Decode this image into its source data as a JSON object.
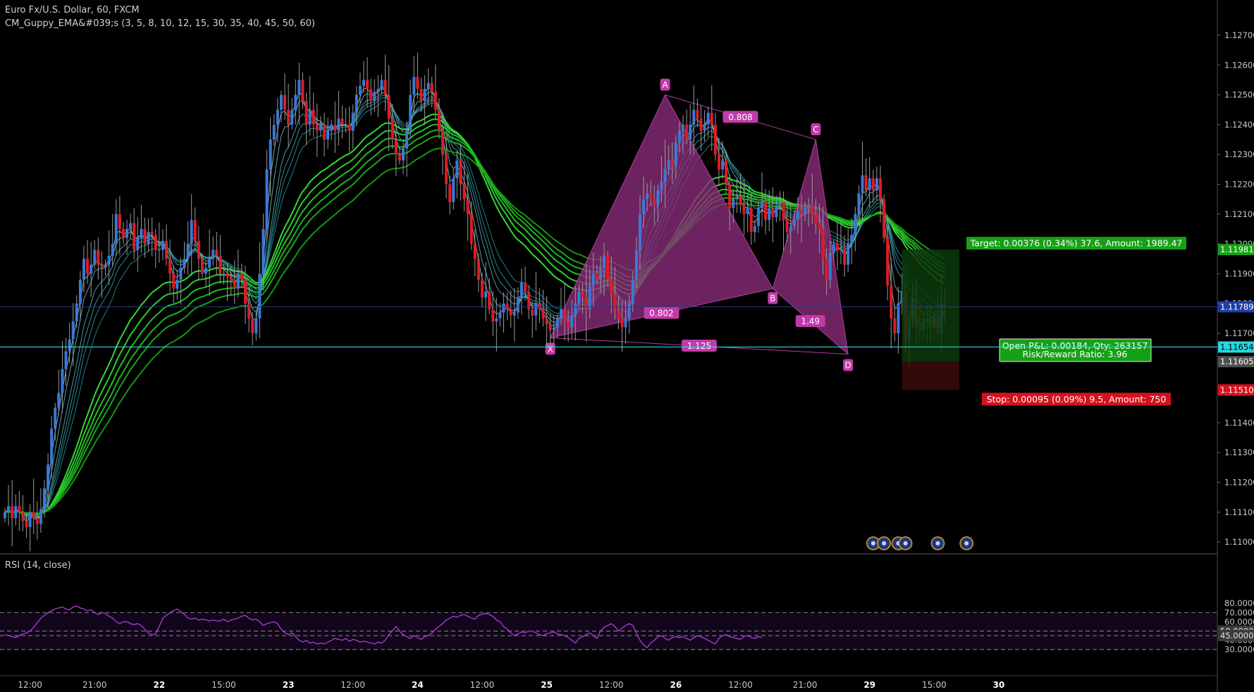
{
  "header": {
    "title": "Euro Fx/U.S. Dollar, 60, FXCM",
    "indicator": "CM_Guppy_EMA&#039;s (3, 5, 8, 10, 12, 15, 30, 35, 40, 45, 50, 60)"
  },
  "rsi_panel": {
    "title": "RSI (14, close)"
  },
  "colors": {
    "background": "#000000",
    "bull_candle": "#3a78d8",
    "bear_candle": "#e01b24",
    "short_ema_teal": "#2ec4c4",
    "long_ema_green": "#1fd11f",
    "pattern_fill": "#8a2d7a",
    "pattern_label": "#c03aa8",
    "rsi_line": "#b23cd6",
    "target_green": "#16a016",
    "stop_red": "#d4121e",
    "cyan_line": "#25d9e0",
    "price_line": "#2a3a8a"
  },
  "chart_data": [
    {
      "type": "candlestick",
      "symbol": "EURUSD",
      "timeframe": "60",
      "ylim": [
        1.1093,
        1.1283
      ],
      "y_ticks": [
        "1.12700",
        "1.12600",
        "1.12500",
        "1.12400",
        "1.12300",
        "1.12200",
        "1.12100",
        "1.12000",
        "1.11900",
        "1.11800",
        "1.11700",
        "1.11600",
        "1.11500",
        "1.11400",
        "1.11300",
        "1.11200",
        "1.11100",
        "1.11000"
      ],
      "x_ticks": [
        {
          "i": 7,
          "label": "12:00",
          "bold": false
        },
        {
          "i": 25,
          "label": "21:00",
          "bold": false
        },
        {
          "i": 43,
          "label": "22",
          "bold": true
        },
        {
          "i": 61,
          "label": "15:00",
          "bold": false
        },
        {
          "i": 79,
          "label": "23",
          "bold": true
        },
        {
          "i": 97,
          "label": "12:00",
          "bold": false
        },
        {
          "i": 115,
          "label": "24",
          "bold": true
        },
        {
          "i": 133,
          "label": "12:00",
          "bold": false
        },
        {
          "i": 151,
          "label": "25",
          "bold": true
        },
        {
          "i": 169,
          "label": "12:00",
          "bold": false
        },
        {
          "i": 187,
          "label": "26",
          "bold": true
        },
        {
          "i": 205,
          "label": "12:00",
          "bold": false
        },
        {
          "i": 223,
          "label": "21:00",
          "bold": false
        },
        {
          "i": 241,
          "label": "29",
          "bold": true
        },
        {
          "i": 259,
          "label": "15:00",
          "bold": false
        },
        {
          "i": 277,
          "label": "30",
          "bold": true
        }
      ],
      "closes": [
        1.111,
        1.1112,
        1.1108,
        1.1112,
        1.111,
        1.1107,
        1.1105,
        1.111,
        1.1108,
        1.1106,
        1.1111,
        1.1118,
        1.1126,
        1.1138,
        1.1145,
        1.115,
        1.1158,
        1.1164,
        1.1168,
        1.1174,
        1.118,
        1.1188,
        1.1195,
        1.119,
        1.1193,
        1.1198,
        1.1193,
        1.1192,
        1.1193,
        1.1196,
        1.12,
        1.121,
        1.1205,
        1.1202,
        1.1205,
        1.1207,
        1.1198,
        1.1202,
        1.1205,
        1.12,
        1.1204,
        1.1203,
        1.1198,
        1.1198,
        1.1201,
        1.1195,
        1.119,
        1.1185,
        1.1188,
        1.1192,
        1.1195,
        1.12,
        1.1208,
        1.1201,
        1.1195,
        1.119,
        1.1192,
        1.1195,
        1.1198,
        1.1196,
        1.119,
        1.119,
        1.1189,
        1.1188,
        1.1185,
        1.119,
        1.1188,
        1.118,
        1.1175,
        1.117,
        1.1175,
        1.119,
        1.1205,
        1.1225,
        1.1235,
        1.124,
        1.1245,
        1.125,
        1.1245,
        1.124,
        1.1245,
        1.125,
        1.1255,
        1.1248,
        1.124,
        1.1245,
        1.124,
        1.1238,
        1.124,
        1.1235,
        1.1238,
        1.124,
        1.1238,
        1.1242,
        1.124,
        1.124,
        1.1238,
        1.1244,
        1.125,
        1.1253,
        1.1255,
        1.1252,
        1.1248,
        1.1251,
        1.1252,
        1.1255,
        1.125,
        1.1242,
        1.1235,
        1.123,
        1.1228,
        1.1232,
        1.1238,
        1.125,
        1.1256,
        1.1252,
        1.1248,
        1.1252,
        1.1254,
        1.1251,
        1.1245,
        1.1238,
        1.123,
        1.122,
        1.1214,
        1.1222,
        1.1228,
        1.122,
        1.1215,
        1.121,
        1.12,
        1.1195,
        1.1188,
        1.1182,
        1.1184,
        1.1178,
        1.1174,
        1.1175,
        1.1177,
        1.118,
        1.1178,
        1.1176,
        1.1177,
        1.1182,
        1.1187,
        1.1184,
        1.1178,
        1.1176,
        1.118,
        1.1178,
        1.1175,
        1.1173,
        1.1171,
        1.1172,
        1.1175,
        1.1178,
        1.1174,
        1.1172,
        1.1176,
        1.118,
        1.1184,
        1.1182,
        1.1178,
        1.1186,
        1.119,
        1.1188,
        1.1192,
        1.1196,
        1.1188,
        1.1183,
        1.1178,
        1.1175,
        1.1172,
        1.1175,
        1.118,
        1.1188,
        1.1198,
        1.121,
        1.1215,
        1.1217,
        1.1215,
        1.1213,
        1.1218,
        1.1221,
        1.1225,
        1.1228,
        1.1226,
        1.1234,
        1.1238,
        1.124,
        1.1235,
        1.124,
        1.1245,
        1.1242,
        1.1238,
        1.124,
        1.1244,
        1.124,
        1.123,
        1.1225,
        1.1228,
        1.122,
        1.1212,
        1.1215,
        1.1216,
        1.1213,
        1.121,
        1.1212,
        1.1204,
        1.1206,
        1.1212,
        1.1214,
        1.1208,
        1.1212,
        1.1209,
        1.1213,
        1.1214,
        1.1208,
        1.1204,
        1.1206,
        1.1208,
        1.1211,
        1.121,
        1.1212,
        1.1213,
        1.121,
        1.1207,
        1.1205,
        1.1195,
        1.1188,
        1.1197,
        1.12,
        1.1198,
        1.1199,
        1.1193,
        1.12,
        1.1203,
        1.121,
        1.1217,
        1.1223,
        1.1218,
        1.1222,
        1.1218,
        1.1222,
        1.1215,
        1.1202,
        1.1186,
        1.1175,
        1.117,
        1.118,
        1.1184,
        1.1168,
        1.1174,
        1.1182,
        1.1172,
        1.1171,
        1.1174,
        1.1175,
        1.1172,
        1.1176,
        1.117,
        1.118,
        1.1179
      ],
      "ema_periods": [
        3,
        5,
        8,
        10,
        12,
        15,
        30,
        35,
        40,
        45,
        50,
        60
      ],
      "harmonic_pattern": {
        "points": [
          {
            "label": "X",
            "i": 152,
            "price": 1.11685
          },
          {
            "label": "A",
            "i": 184,
            "price": 1.125
          },
          {
            "label": "B",
            "i": 214,
            "price": 1.1185
          },
          {
            "label": "C",
            "i": 226,
            "price": 1.1235
          },
          {
            "label": "D",
            "i": 235,
            "price": 1.1163
          }
        ],
        "ratios": [
          {
            "label": "0.808",
            "between": [
              "A",
              "C"
            ]
          },
          {
            "label": "0.802",
            "between": [
              "X",
              "B"
            ]
          },
          {
            "label": "1.49",
            "between": [
              "B",
              "D"
            ]
          },
          {
            "label": "1.125",
            "between": [
              "X",
              "D"
            ]
          }
        ]
      },
      "position": {
        "entry": 1.11605,
        "target_price": 1.11981,
        "stop_price": 1.1151,
        "start_i": 250,
        "end_i": 266,
        "target_label": "Target: 0.00376 (0.34%) 37.6, Amount: 1989.47",
        "stop_label": "Stop: 0.00095 (0.09%) 9.5, Amount: 750",
        "pnl_label_1": "Open P&L: 0.00184, Qty: 263157",
        "pnl_label_2": "Risk/Reward Ratio: 3.96"
      },
      "price_line": 1.11789,
      "horizontal_line": 1.11654,
      "price_tags": [
        {
          "price": 1.11981,
          "label": "1.11981",
          "color": "#16a016"
        },
        {
          "price": 1.11789,
          "label": "1.11789",
          "color": "#1e3ea8"
        },
        {
          "price": 1.11654,
          "label": "1.11654",
          "color": "#25d9e0"
        },
        {
          "price": 1.11605,
          "label": "1.11605",
          "color": "#505050"
        },
        {
          "price": 1.1151,
          "label": "1.11510",
          "color": "#d4121e"
        }
      ],
      "event_markers": [
        242,
        245,
        249,
        251,
        260,
        268
      ]
    },
    {
      "type": "line",
      "name": "RSI (14, close)",
      "ylim": [
        27,
        82
      ],
      "y_ticks": [
        "80.0000",
        "70.0000",
        "60.0000",
        "50.0000",
        "40.0000",
        "30.0000"
      ],
      "levels": [
        70,
        50,
        45,
        30
      ],
      "level_tags": [
        "50.0000",
        "45.0000"
      ],
      "values": [
        46,
        45,
        44,
        43,
        45,
        47,
        48,
        50,
        54,
        59,
        64,
        67,
        70,
        72,
        74,
        75,
        76,
        74,
        73,
        76,
        77,
        75,
        74,
        72,
        73,
        70,
        68,
        70,
        69,
        66,
        64,
        60,
        58,
        60,
        60,
        58,
        57,
        58,
        56,
        52,
        48,
        46,
        47,
        55,
        64,
        67,
        70,
        72,
        74,
        71,
        68,
        64,
        63,
        64,
        62,
        63,
        62,
        61,
        62,
        61,
        61,
        63,
        60,
        62,
        63,
        64,
        66,
        67,
        64,
        62,
        63,
        60,
        56,
        58,
        59,
        60,
        58,
        52,
        48,
        46,
        48,
        44,
        40,
        38,
        40,
        37,
        38,
        36,
        37,
        36,
        38,
        40,
        42,
        41,
        40,
        42,
        39,
        41,
        40,
        38,
        39,
        38,
        37,
        36,
        38,
        37,
        40,
        46,
        50,
        55,
        50,
        46,
        44,
        42,
        45,
        43,
        41,
        44,
        45,
        48,
        52,
        55,
        58,
        62,
        64,
        66,
        65,
        67,
        68,
        66,
        64,
        63,
        67,
        68,
        69,
        68,
        66,
        62,
        60,
        55,
        52,
        48,
        45,
        47,
        49,
        48,
        50,
        50,
        48,
        46,
        45,
        47,
        48,
        49,
        47,
        46,
        45,
        43,
        40,
        37,
        42,
        44,
        46,
        48,
        45,
        42,
        50,
        54,
        56,
        58,
        55,
        50,
        53,
        56,
        58,
        56,
        48,
        40,
        35,
        32,
        37,
        40,
        44,
        45,
        42,
        40,
        43,
        44,
        43,
        44,
        42,
        40,
        43,
        45,
        44,
        42,
        40,
        38,
        36,
        42,
        45,
        46,
        44,
        43,
        42,
        41,
        44,
        45,
        43,
        42,
        44,
        43
      ]
    }
  ]
}
